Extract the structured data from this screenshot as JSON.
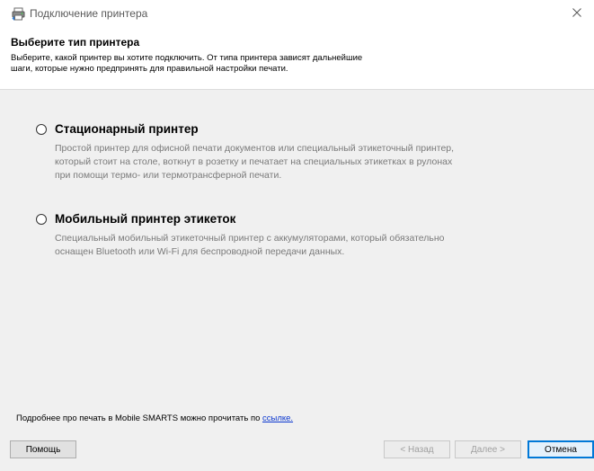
{
  "window": {
    "title": "Подключение принтера",
    "icon": "printer-app-icon",
    "close_icon": "close-icon"
  },
  "header": {
    "title": "Выберите тип принтера",
    "description_line1": "Выберите, какой принтер вы хотите подключить. От типа принтера зависят дальнейшие",
    "description_line2": "шаги, которые нужно предпринять для правильной настройки печати."
  },
  "options": [
    {
      "label": "Стационарный принтер",
      "selected": false,
      "description_lines": [
        "Простой принтер для офисной печати документов или специальный этикеточный принтер,",
        "который стоит на столе, воткнут в розетку и печатает на специальных этикетках в рулонах",
        "при помощи термо- или термотрансферной печати."
      ]
    },
    {
      "label": "Мобильный принтер этикеток",
      "selected": false,
      "description_lines": [
        "Специальный мобильный этикеточный принтер с аккумуляторами, который обязательно",
        "оснащен Bluetooth или Wi-Fi для беспроводной передачи данных."
      ]
    }
  ],
  "footer": {
    "note_text": "Подробнее про печать в Mobile SMARTS можно прочитать по ",
    "link_text": "ссылке."
  },
  "buttons": {
    "help": "Помощь",
    "back": "< Назад",
    "next": "Далее >",
    "cancel": "Отмена"
  },
  "colors": {
    "link": "#0a36cf",
    "focus_border": "#0078d7",
    "body_background": "#f0f0f0",
    "description_text": "#7a7a7a"
  }
}
